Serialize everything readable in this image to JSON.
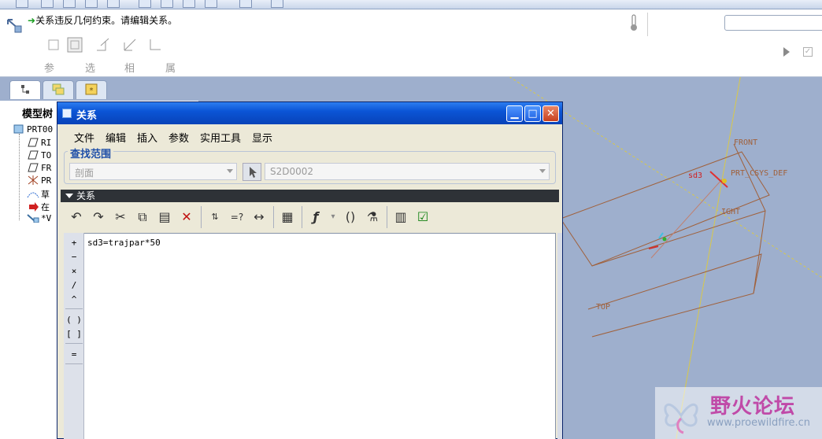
{
  "dashboard": {
    "message": "关系违反几何约束。请编辑关系。",
    "tabs": [
      "参照",
      "选项",
      "相切",
      "属性"
    ]
  },
  "model_tree": {
    "tab_icons": [
      "tree-icon",
      "layers-icon",
      "favorites-icon"
    ],
    "header": "模型树",
    "items": [
      {
        "label": "PRT00",
        "icon": "part-icon"
      },
      {
        "label": "RI",
        "icon": "datum-plane-icon"
      },
      {
        "label": "TO",
        "icon": "datum-plane-icon"
      },
      {
        "label": "FR",
        "icon": "datum-plane-icon"
      },
      {
        "label": "PR",
        "icon": "csys-icon"
      },
      {
        "label": "草",
        "icon": "sketch-icon"
      },
      {
        "label": "在",
        "icon": "insert-here-icon"
      },
      {
        "label": "*V",
        "icon": "sweep-icon"
      }
    ]
  },
  "view3d": {
    "labels": {
      "front": "FRONT",
      "prt_csys": "PRT_CSYS_DEF",
      "right": "IGHT",
      "top": "TOP",
      "dim": "sd3"
    }
  },
  "dialog": {
    "title": "关系",
    "menu": [
      "文件",
      "编辑",
      "插入",
      "参数",
      "实用工具",
      "显示"
    ],
    "scope_label": "查找范围",
    "scope_combo": "剖面",
    "scope_item": "S2D0002",
    "relations_header": "关系",
    "toolbar_icons": [
      "undo-icon",
      "redo-icon",
      "cut-icon",
      "copy-icon",
      "paste-icon",
      "delete-icon",
      "sort-relations-icon",
      "evaluate-icon",
      "show-dimension-icon",
      "local-params-icon",
      "function-icon",
      "parentheses-icon",
      "verify-icon",
      "sort-icon",
      "check-icon"
    ],
    "operators": [
      "+",
      "−",
      "×",
      "/",
      "^",
      "( )",
      "[ ]",
      "="
    ],
    "relation_text": "sd3=trajpar*50"
  },
  "watermark": {
    "title": "野火论坛",
    "url": "www.proewildfire.cn"
  }
}
